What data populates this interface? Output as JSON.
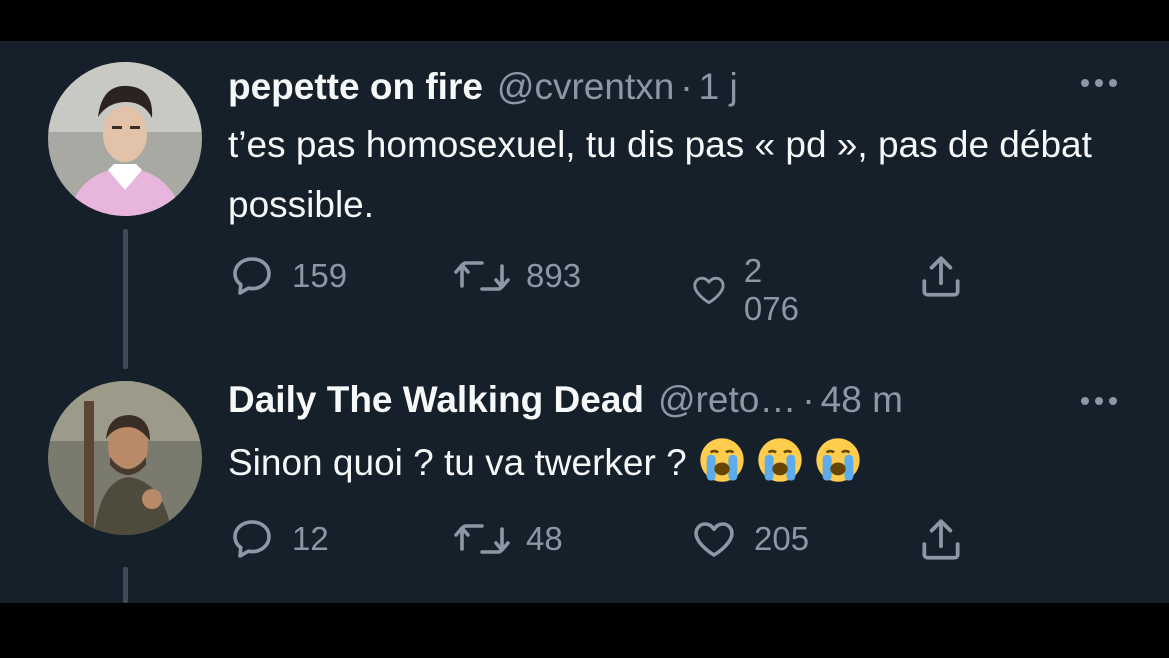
{
  "tweets": [
    {
      "display_name": "pepette on fire",
      "handle": "@cvrentxn",
      "separator": "·",
      "time": "1 j",
      "text": "t’es pas homosexuel, tu dis pas « pd », pas de débat possible.",
      "replies": "159",
      "retweets": "893",
      "likes": "2 076"
    },
    {
      "display_name": "Daily The Walking Dead",
      "handle": "@reto…",
      "separator": "·",
      "time": "48 m",
      "text": "Sinon quoi ? tu va twerker ?",
      "emojis": [
        "loudly-crying-face",
        "loudly-crying-face",
        "loudly-crying-face"
      ],
      "replies": "12",
      "retweets": "48",
      "likes": "205"
    }
  ],
  "colors": {
    "background": "#15202b",
    "frame": "#000000",
    "primary_text": "#f7f9f9",
    "secondary_text": "#8b98a5",
    "thread_line": "#3d4a57"
  }
}
